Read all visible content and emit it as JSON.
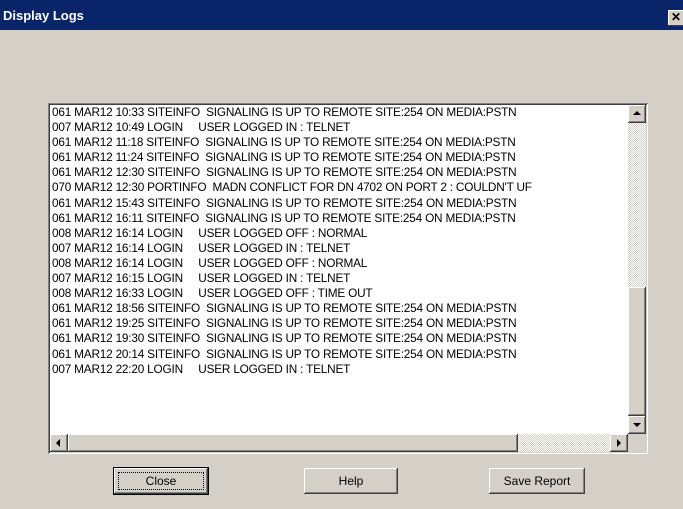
{
  "window": {
    "title": "Display Logs",
    "close_glyph": "✕"
  },
  "log_lines": [
    "061 MAR12 10:33 SITEINFO  SIGNALING IS UP TO REMOTE SITE:254 ON MEDIA:PSTN",
    "007 MAR12 10:49 LOGIN     USER LOGGED IN : TELNET",
    "061 MAR12 11:18 SITEINFO  SIGNALING IS UP TO REMOTE SITE:254 ON MEDIA:PSTN",
    "061 MAR12 11:24 SITEINFO  SIGNALING IS UP TO REMOTE SITE:254 ON MEDIA:PSTN",
    "061 MAR12 12:30 SITEINFO  SIGNALING IS UP TO REMOTE SITE:254 ON MEDIA:PSTN",
    "070 MAR12 12:30 PORTINFO  MADN CONFLICT FOR DN 4702 ON PORT 2 : COULDN'T UF",
    "061 MAR12 15:43 SITEINFO  SIGNALING IS UP TO REMOTE SITE:254 ON MEDIA:PSTN",
    "061 MAR12 16:11 SITEINFO  SIGNALING IS UP TO REMOTE SITE:254 ON MEDIA:PSTN",
    "008 MAR12 16:14 LOGIN     USER LOGGED OFF : NORMAL",
    "007 MAR12 16:14 LOGIN     USER LOGGED IN : TELNET",
    "008 MAR12 16:14 LOGIN     USER LOGGED OFF : NORMAL",
    "007 MAR12 16:15 LOGIN     USER LOGGED IN : TELNET",
    "008 MAR12 16:33 LOGIN     USER LOGGED OFF : TIME OUT",
    "061 MAR12 18:56 SITEINFO  SIGNALING IS UP TO REMOTE SITE:254 ON MEDIA:PSTN",
    "061 MAR12 19:25 SITEINFO  SIGNALING IS UP TO REMOTE SITE:254 ON MEDIA:PSTN",
    "061 MAR12 19:30 SITEINFO  SIGNALING IS UP TO REMOTE SITE:254 ON MEDIA:PSTN",
    "061 MAR12 20:14 SITEINFO  SIGNALING IS UP TO REMOTE SITE:254 ON MEDIA:PSTN",
    "007 MAR12 22:20 LOGIN     USER LOGGED IN : TELNET"
  ],
  "buttons": {
    "close": "Close",
    "help": "Help",
    "save_report": "Save Report"
  }
}
